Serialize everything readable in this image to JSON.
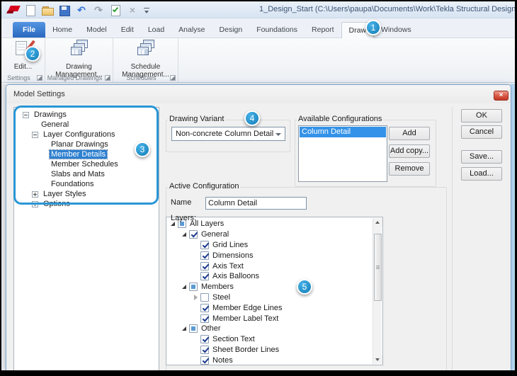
{
  "titlebar": {
    "title": "1_Design_Start (C:\\Users\\paupa\\Documents\\Work\\Tekla Structural Design"
  },
  "quick_access": {
    "icons": [
      "tekla-logo",
      "new-document",
      "open",
      "save",
      "undo",
      "redo",
      "validate",
      "delete",
      "more-commands"
    ],
    "undo_glyph": "↶",
    "redo_glyph": "↷",
    "delete_glyph": "×"
  },
  "tabs": {
    "active": "Draw",
    "items": [
      {
        "label": "File"
      },
      {
        "label": "Home"
      },
      {
        "label": "Model"
      },
      {
        "label": "Edit"
      },
      {
        "label": "Load"
      },
      {
        "label": "Analyse"
      },
      {
        "label": "Design"
      },
      {
        "label": "Foundations"
      },
      {
        "label": "Report"
      },
      {
        "label": "Draw"
      },
      {
        "label": "Windows"
      }
    ]
  },
  "ribbon": {
    "groups": [
      {
        "label": "Settings",
        "button": "Edit..."
      },
      {
        "label": "Managed Drawings",
        "button": "Drawing Management..."
      },
      {
        "label": "Schedules",
        "button": "Schedule Management..."
      }
    ]
  },
  "badges": [
    {
      "label": "1"
    },
    {
      "label": "2"
    },
    {
      "label": "3"
    },
    {
      "label": "4"
    },
    {
      "label": "5"
    }
  ],
  "dialog": {
    "title": "Model Settings",
    "close_glyph": "×",
    "tree": {
      "items": [
        {
          "label": "Drawings",
          "level": 0,
          "expander": "minus"
        },
        {
          "label": "General",
          "level": 1,
          "expander": "none"
        },
        {
          "label": "Layer Configurations",
          "level": 1,
          "expander": "minus"
        },
        {
          "label": "Planar Drawings",
          "level": 2,
          "expander": "none"
        },
        {
          "label": "Member Details",
          "level": 2,
          "expander": "none",
          "selected": true
        },
        {
          "label": "Member Schedules",
          "level": 2,
          "expander": "none"
        },
        {
          "label": "Slabs and Mats",
          "level": 2,
          "expander": "none"
        },
        {
          "label": "Foundations",
          "level": 2,
          "expander": "none"
        },
        {
          "label": "Layer Styles",
          "level": 1,
          "expander": "plus"
        },
        {
          "label": "Options",
          "level": 1,
          "expander": "plus"
        }
      ]
    },
    "drawing_variant": {
      "label": "Drawing Variant",
      "value": "Non-concrete Column Detail"
    },
    "available_configurations": {
      "label": "Available Configurations",
      "items": [
        {
          "label": "Column Detail",
          "selected": true
        }
      ],
      "buttons": {
        "add": "Add",
        "add_copy": "Add copy...",
        "remove": "Remove"
      }
    },
    "active_configuration": {
      "label": "Active Configuration",
      "name_label": "Name",
      "name_value": "Column Detail",
      "layers_label": "Layers:",
      "layers": [
        {
          "label": "All Layers",
          "level": 0,
          "check": "partial",
          "expander": "open"
        },
        {
          "label": "General",
          "level": 1,
          "check": "checked",
          "expander": "open"
        },
        {
          "label": "Grid Lines",
          "level": 2,
          "check": "checked",
          "expander": "none"
        },
        {
          "label": "Dimensions",
          "level": 2,
          "check": "checked",
          "expander": "none"
        },
        {
          "label": "Axis Text",
          "level": 2,
          "check": "checked",
          "expander": "none"
        },
        {
          "label": "Axis Balloons",
          "level": 2,
          "check": "checked",
          "expander": "none"
        },
        {
          "label": "Members",
          "level": 1,
          "check": "partial",
          "expander": "open"
        },
        {
          "label": "Steel",
          "level": 2,
          "check": "unchecked",
          "expander": "closed"
        },
        {
          "label": "Member Edge Lines",
          "level": 2,
          "check": "checked",
          "expander": "none"
        },
        {
          "label": "Member Label Text",
          "level": 2,
          "check": "checked",
          "expander": "none"
        },
        {
          "label": "Other",
          "level": 1,
          "check": "partial",
          "expander": "open"
        },
        {
          "label": "Section Text",
          "level": 2,
          "check": "checked",
          "expander": "none"
        },
        {
          "label": "Sheet Border Lines",
          "level": 2,
          "check": "checked",
          "expander": "none"
        },
        {
          "label": "Notes",
          "level": 2,
          "check": "checked",
          "expander": "none"
        }
      ]
    },
    "buttons": {
      "ok": "OK",
      "cancel": "Cancel",
      "save": "Save...",
      "load": "Load..."
    }
  },
  "colors": {
    "badge": "#2196cf",
    "selection_blue": "#3492e8",
    "file_tab_blue": "#2a68bf",
    "close_button_red": "#d4503d"
  }
}
